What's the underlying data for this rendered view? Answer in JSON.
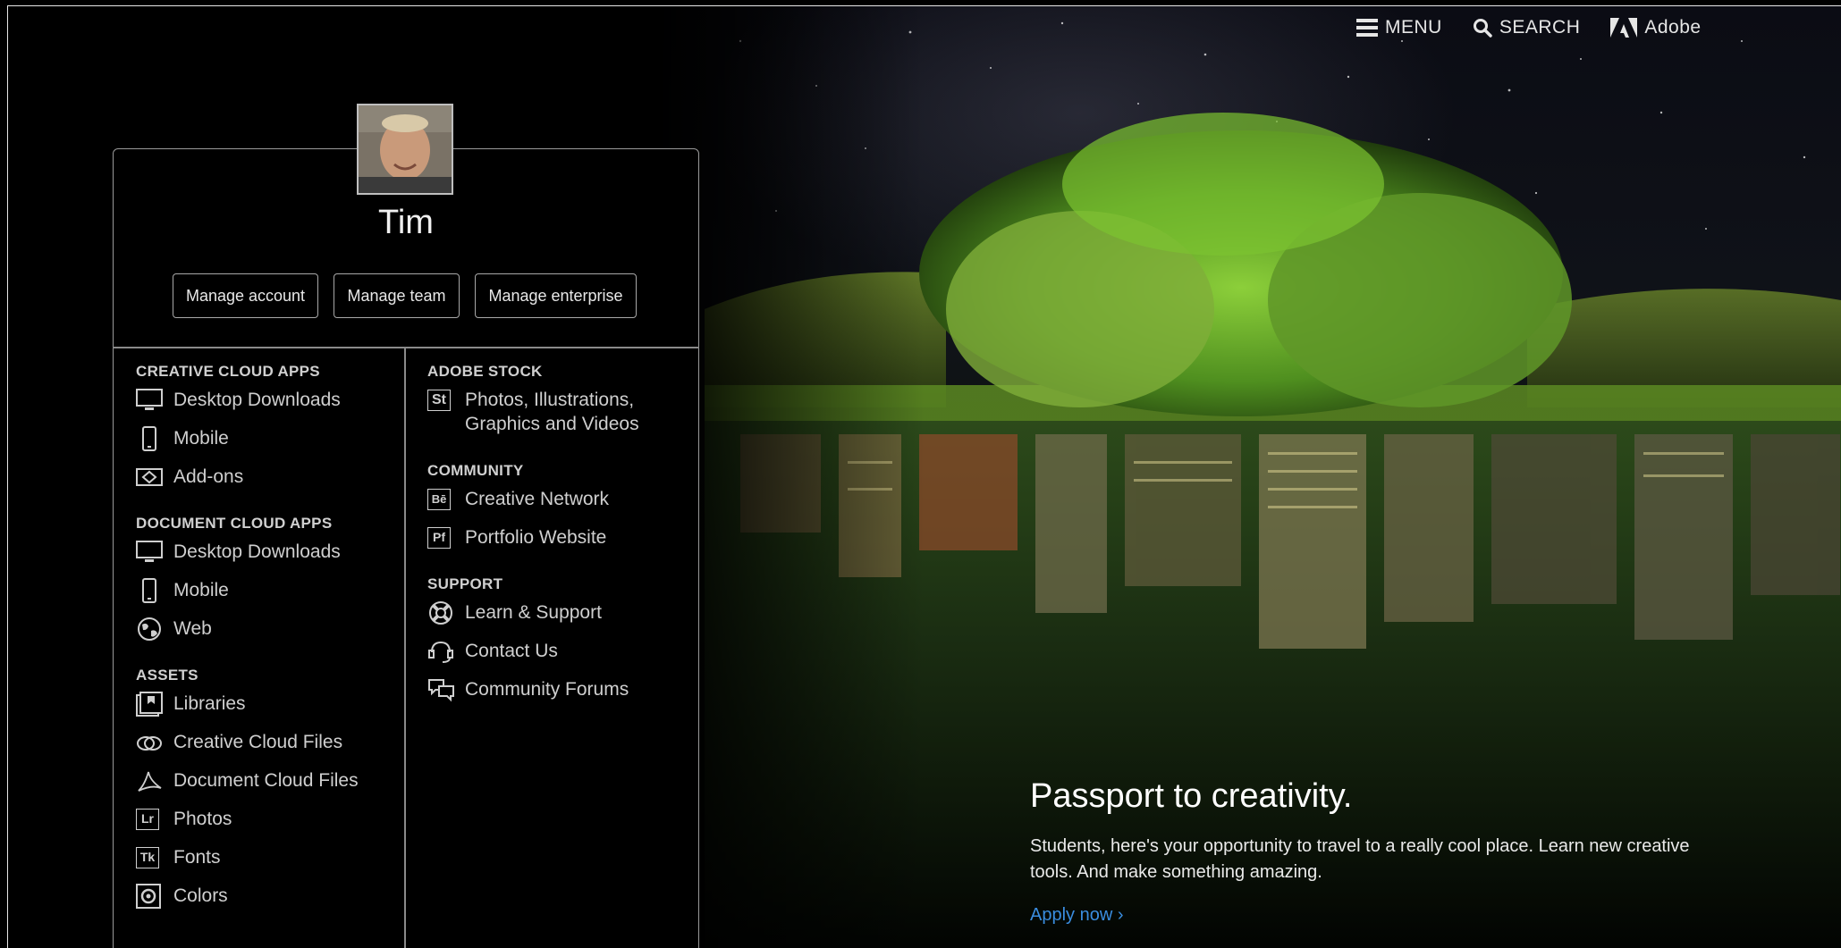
{
  "topnav": {
    "menu_label": "MENU",
    "search_label": "SEARCH",
    "brand_label": "Adobe"
  },
  "profile": {
    "name": "Tim",
    "buttons": {
      "manage_account": "Manage account",
      "manage_team": "Manage team",
      "manage_enterprise": "Manage enterprise"
    }
  },
  "left_column": {
    "creative_cloud_apps": {
      "heading": "CREATIVE CLOUD APPS",
      "items": [
        {
          "label": "Desktop Downloads",
          "icon": "monitor-icon"
        },
        {
          "label": "Mobile",
          "icon": "phone-icon"
        },
        {
          "label": "Add-ons",
          "icon": "addons-icon"
        }
      ]
    },
    "document_cloud_apps": {
      "heading": "DOCUMENT CLOUD APPS",
      "items": [
        {
          "label": "Desktop Downloads",
          "icon": "monitor-icon"
        },
        {
          "label": "Mobile",
          "icon": "phone-icon"
        },
        {
          "label": "Web",
          "icon": "globe-icon"
        }
      ]
    },
    "assets": {
      "heading": "ASSETS",
      "items": [
        {
          "label": "Libraries",
          "icon": "libraries-icon"
        },
        {
          "label": "Creative Cloud Files",
          "icon": "creative-cloud-icon"
        },
        {
          "label": "Document Cloud Files",
          "icon": "acrobat-icon"
        },
        {
          "label": "Photos",
          "icon": "lightroom-icon",
          "badge": "Lr"
        },
        {
          "label": "Fonts",
          "icon": "typekit-icon",
          "badge": "Tk"
        },
        {
          "label": "Colors",
          "icon": "color-icon"
        }
      ]
    }
  },
  "right_column": {
    "adobe_stock": {
      "heading": "ADOBE STOCK",
      "items": [
        {
          "label": "Photos, Illustrations, Graphics and Videos",
          "icon": "stock-icon",
          "badge": "St"
        }
      ]
    },
    "community": {
      "heading": "COMMUNITY",
      "items": [
        {
          "label": "Creative Network",
          "icon": "behance-icon",
          "badge": "Bē"
        },
        {
          "label": "Portfolio Website",
          "icon": "portfolio-icon",
          "badge": "Pf"
        }
      ]
    },
    "support": {
      "heading": "SUPPORT",
      "items": [
        {
          "label": "Learn & Support",
          "icon": "lifebuoy-icon"
        },
        {
          "label": "Contact Us",
          "icon": "headset-icon"
        },
        {
          "label": "Community Forums",
          "icon": "chat-bubbles-icon"
        }
      ]
    }
  },
  "promo": {
    "title": "Passport to creativity.",
    "body": "Students, here's your opportunity to travel to a really cool place. Learn new creative tools. And make something amazing.",
    "link": "Apply now ›"
  },
  "colors": {
    "background": "#000000",
    "link_blue": "#3a8de0",
    "text": "#cfcfcf",
    "border": "#9a9a9a"
  }
}
